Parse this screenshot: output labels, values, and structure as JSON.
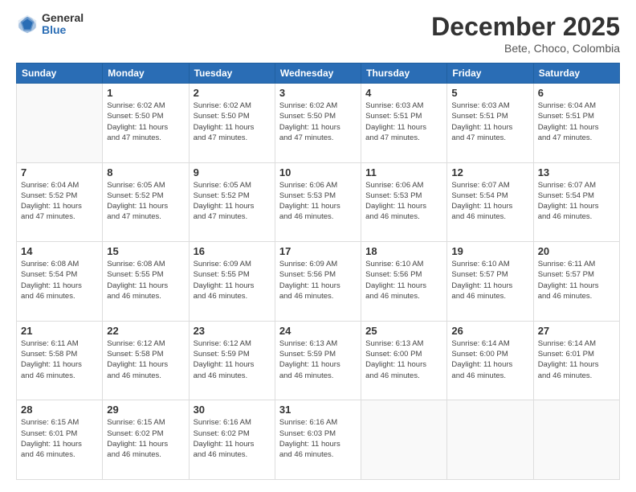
{
  "logo": {
    "general": "General",
    "blue": "Blue"
  },
  "title": "December 2025",
  "location": "Bete, Choco, Colombia",
  "days_of_week": [
    "Sunday",
    "Monday",
    "Tuesday",
    "Wednesday",
    "Thursday",
    "Friday",
    "Saturday"
  ],
  "weeks": [
    [
      {
        "day": "",
        "info": ""
      },
      {
        "day": "1",
        "info": "Sunrise: 6:02 AM\nSunset: 5:50 PM\nDaylight: 11 hours\nand 47 minutes."
      },
      {
        "day": "2",
        "info": "Sunrise: 6:02 AM\nSunset: 5:50 PM\nDaylight: 11 hours\nand 47 minutes."
      },
      {
        "day": "3",
        "info": "Sunrise: 6:02 AM\nSunset: 5:50 PM\nDaylight: 11 hours\nand 47 minutes."
      },
      {
        "day": "4",
        "info": "Sunrise: 6:03 AM\nSunset: 5:51 PM\nDaylight: 11 hours\nand 47 minutes."
      },
      {
        "day": "5",
        "info": "Sunrise: 6:03 AM\nSunset: 5:51 PM\nDaylight: 11 hours\nand 47 minutes."
      },
      {
        "day": "6",
        "info": "Sunrise: 6:04 AM\nSunset: 5:51 PM\nDaylight: 11 hours\nand 47 minutes."
      }
    ],
    [
      {
        "day": "7",
        "info": "Sunrise: 6:04 AM\nSunset: 5:52 PM\nDaylight: 11 hours\nand 47 minutes."
      },
      {
        "day": "8",
        "info": "Sunrise: 6:05 AM\nSunset: 5:52 PM\nDaylight: 11 hours\nand 47 minutes."
      },
      {
        "day": "9",
        "info": "Sunrise: 6:05 AM\nSunset: 5:52 PM\nDaylight: 11 hours\nand 47 minutes."
      },
      {
        "day": "10",
        "info": "Sunrise: 6:06 AM\nSunset: 5:53 PM\nDaylight: 11 hours\nand 46 minutes."
      },
      {
        "day": "11",
        "info": "Sunrise: 6:06 AM\nSunset: 5:53 PM\nDaylight: 11 hours\nand 46 minutes."
      },
      {
        "day": "12",
        "info": "Sunrise: 6:07 AM\nSunset: 5:54 PM\nDaylight: 11 hours\nand 46 minutes."
      },
      {
        "day": "13",
        "info": "Sunrise: 6:07 AM\nSunset: 5:54 PM\nDaylight: 11 hours\nand 46 minutes."
      }
    ],
    [
      {
        "day": "14",
        "info": "Sunrise: 6:08 AM\nSunset: 5:54 PM\nDaylight: 11 hours\nand 46 minutes."
      },
      {
        "day": "15",
        "info": "Sunrise: 6:08 AM\nSunset: 5:55 PM\nDaylight: 11 hours\nand 46 minutes."
      },
      {
        "day": "16",
        "info": "Sunrise: 6:09 AM\nSunset: 5:55 PM\nDaylight: 11 hours\nand 46 minutes."
      },
      {
        "day": "17",
        "info": "Sunrise: 6:09 AM\nSunset: 5:56 PM\nDaylight: 11 hours\nand 46 minutes."
      },
      {
        "day": "18",
        "info": "Sunrise: 6:10 AM\nSunset: 5:56 PM\nDaylight: 11 hours\nand 46 minutes."
      },
      {
        "day": "19",
        "info": "Sunrise: 6:10 AM\nSunset: 5:57 PM\nDaylight: 11 hours\nand 46 minutes."
      },
      {
        "day": "20",
        "info": "Sunrise: 6:11 AM\nSunset: 5:57 PM\nDaylight: 11 hours\nand 46 minutes."
      }
    ],
    [
      {
        "day": "21",
        "info": "Sunrise: 6:11 AM\nSunset: 5:58 PM\nDaylight: 11 hours\nand 46 minutes."
      },
      {
        "day": "22",
        "info": "Sunrise: 6:12 AM\nSunset: 5:58 PM\nDaylight: 11 hours\nand 46 minutes."
      },
      {
        "day": "23",
        "info": "Sunrise: 6:12 AM\nSunset: 5:59 PM\nDaylight: 11 hours\nand 46 minutes."
      },
      {
        "day": "24",
        "info": "Sunrise: 6:13 AM\nSunset: 5:59 PM\nDaylight: 11 hours\nand 46 minutes."
      },
      {
        "day": "25",
        "info": "Sunrise: 6:13 AM\nSunset: 6:00 PM\nDaylight: 11 hours\nand 46 minutes."
      },
      {
        "day": "26",
        "info": "Sunrise: 6:14 AM\nSunset: 6:00 PM\nDaylight: 11 hours\nand 46 minutes."
      },
      {
        "day": "27",
        "info": "Sunrise: 6:14 AM\nSunset: 6:01 PM\nDaylight: 11 hours\nand 46 minutes."
      }
    ],
    [
      {
        "day": "28",
        "info": "Sunrise: 6:15 AM\nSunset: 6:01 PM\nDaylight: 11 hours\nand 46 minutes."
      },
      {
        "day": "29",
        "info": "Sunrise: 6:15 AM\nSunset: 6:02 PM\nDaylight: 11 hours\nand 46 minutes."
      },
      {
        "day": "30",
        "info": "Sunrise: 6:16 AM\nSunset: 6:02 PM\nDaylight: 11 hours\nand 46 minutes."
      },
      {
        "day": "31",
        "info": "Sunrise: 6:16 AM\nSunset: 6:03 PM\nDaylight: 11 hours\nand 46 minutes."
      },
      {
        "day": "",
        "info": ""
      },
      {
        "day": "",
        "info": ""
      },
      {
        "day": "",
        "info": ""
      }
    ]
  ]
}
